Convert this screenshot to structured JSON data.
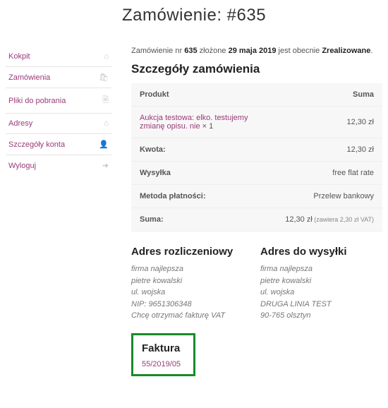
{
  "title_prefix": "Zamówienie: ",
  "title_order": "#635",
  "sidebar": [
    {
      "label": "Kokpit",
      "icon": "⌂"
    },
    {
      "label": "Zamówienia",
      "icon": "🛍"
    },
    {
      "label": "Pliki do pobrania",
      "icon": "🗎"
    },
    {
      "label": "Adresy",
      "icon": "⌂"
    },
    {
      "label": "Szczegóły konta",
      "icon": "👤"
    },
    {
      "label": "Wyloguj",
      "icon": "➜"
    }
  ],
  "status": {
    "pre": "Zamówienie nr ",
    "order_no": "635",
    "mid1": " złożone ",
    "date": "29 maja 2019",
    "mid2": " jest obecnie ",
    "state": "Zrealizowane",
    "end": "."
  },
  "details": {
    "heading": "Szczegóły zamówienia",
    "col_product": "Produkt",
    "col_sum": "Suma",
    "product": {
      "name": "Aukcja testowa: elko. testujemy zmianę opisu. nie",
      "qty": " × 1",
      "price": "12,30 zł"
    },
    "rows": [
      {
        "label": "Kwota:",
        "value": "12,30 zł"
      },
      {
        "label": "Wysyłka",
        "value": "free flat rate"
      },
      {
        "label": "Metoda płatności:",
        "value": "Przelew bankowy"
      }
    ],
    "total": {
      "label": "Suma:",
      "value": "12,30 zł",
      "note": " (zawiera 2,30 zł VAT)"
    }
  },
  "billing": {
    "heading": "Adres rozliczeniowy",
    "lines": [
      "firma najlepsza",
      "pietre kowalski",
      "ul. wojska",
      "NIP: 9651306348",
      "Chcę otrzymać fakturę VAT"
    ]
  },
  "shipping": {
    "heading": "Adres do wysyłki",
    "lines": [
      "firma najlepsza",
      "pietre kowalski",
      "ul. wojska",
      "DRUGA LINIA TEST",
      "90-765 olsztyn"
    ]
  },
  "invoice": {
    "heading": "Faktura",
    "number": "55/2019/05"
  }
}
